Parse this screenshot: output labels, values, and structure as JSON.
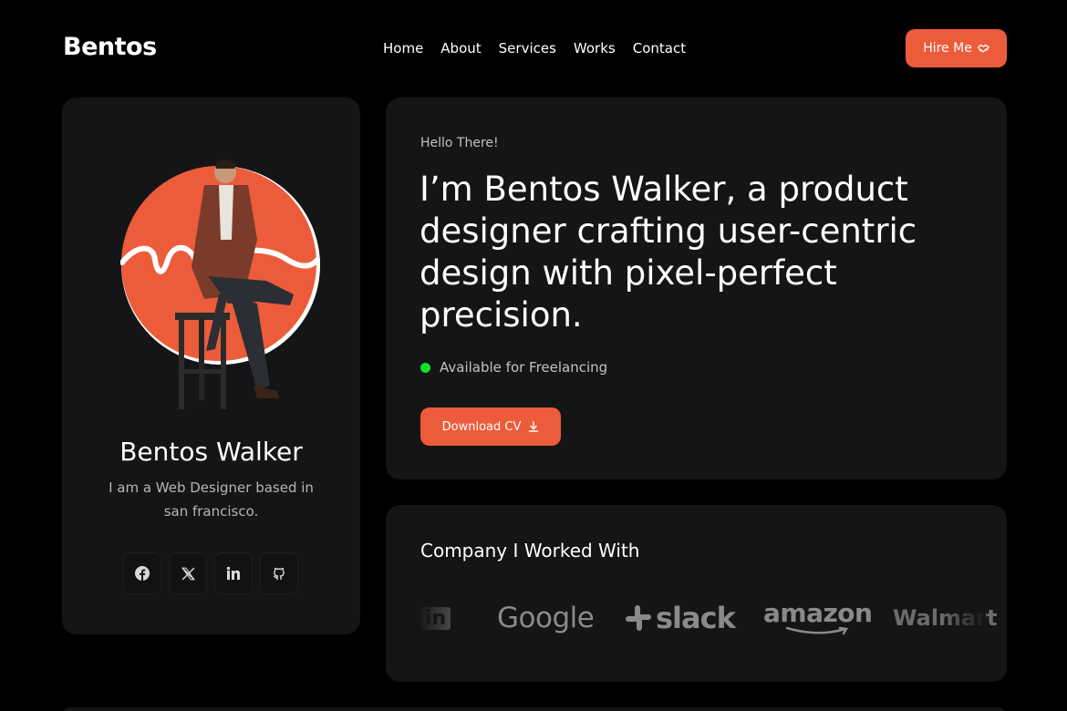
{
  "header": {
    "logo": "Bentos",
    "nav": [
      "Home",
      "About",
      "Services",
      "Works",
      "Contact"
    ],
    "hire_label": "Hire Me",
    "hire_icon": "handshake-icon"
  },
  "profile": {
    "name": "Bentos Walker",
    "bio": "I am a Web Designer based in san francisco.",
    "socials": [
      "facebook-icon",
      "x-icon",
      "linkedin-icon",
      "github-icon"
    ]
  },
  "hero": {
    "greeting": "Hello There!",
    "headline": "I’m Bentos Walker, a product designer crafting user-centric design with pixel-perfect precision.",
    "status": "Available for Freelancing",
    "cv_label": "Download CV",
    "cv_icon": "download-icon"
  },
  "companies": {
    "title": "Company I Worked With",
    "logos": [
      "in",
      "Google",
      "slack",
      "amazon",
      "Walmart"
    ]
  },
  "colors": {
    "accent": "#ec5c3a",
    "background": "#000000",
    "card": "#151517",
    "status_dot": "#10e22a"
  }
}
